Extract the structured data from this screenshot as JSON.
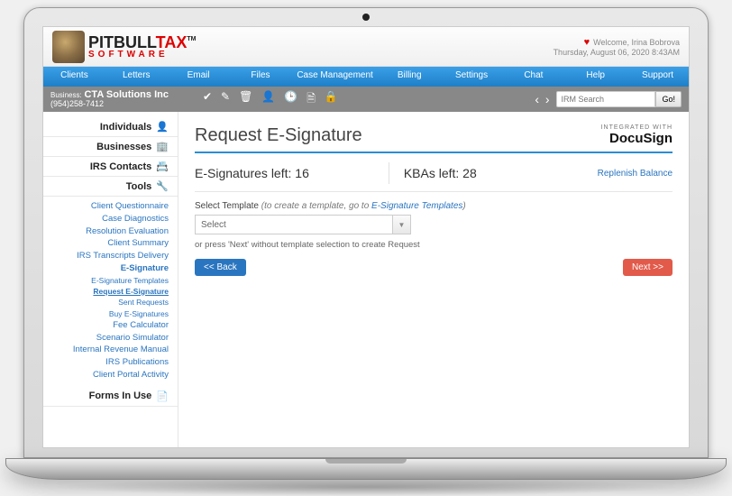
{
  "header": {
    "logo_main": "PITBULL",
    "logo_tax": "TAX",
    "logo_tm": "TM",
    "logo_sub": "SOFTWARE",
    "welcome": "Welcome, Irina Bobrova",
    "timestamp": "Thursday, August 06, 2020 8:43AM"
  },
  "nav": {
    "items": [
      "Clients",
      "Letters",
      "Email",
      "Files",
      "Case Management",
      "Billing",
      "Settings",
      "Chat",
      "Help",
      "Support"
    ]
  },
  "subbar": {
    "business_label": "Business:",
    "business_name": "CTA Solutions Inc",
    "business_phone": "(954)258-7412",
    "search_placeholder": "IRM Search",
    "go_label": "Go!"
  },
  "sidebar": {
    "sections": {
      "individuals": "Individuals",
      "businesses": "Businesses",
      "irs_contacts": "IRS Contacts",
      "tools": "Tools",
      "forms": "Forms In Use"
    },
    "tools": [
      "Client Questionnaire",
      "Case Diagnostics",
      "Resolution Evaluation",
      "Client Summary",
      "IRS Transcripts Delivery",
      "E-Signature",
      "E-Signature Templates",
      "Request E-Signature",
      "Sent Requests",
      "Buy E-Signatures",
      "Fee Calculator",
      "Scenario Simulator",
      "Internal Revenue Manual",
      "IRS Publications",
      "Client Portal Activity"
    ]
  },
  "main": {
    "title": "Request E-Signature",
    "integrated_with": "INTEGRATED WITH",
    "docusign": "DocuSign",
    "esig_label": "E-Signatures left: ",
    "esig_count": "16",
    "kba_label": "KBAs left: ",
    "kba_count": "28",
    "replenish": "Replenish Balance",
    "select_label": "Select Template ",
    "select_hint_prefix": "(to create a template, go to ",
    "select_hint_link": "E-Signature Templates",
    "select_hint_suffix": ")",
    "select_value": "Select",
    "or_text": "or press 'Next' without template selection to create Request",
    "back_btn": "<< Back",
    "next_btn": "Next >>"
  }
}
